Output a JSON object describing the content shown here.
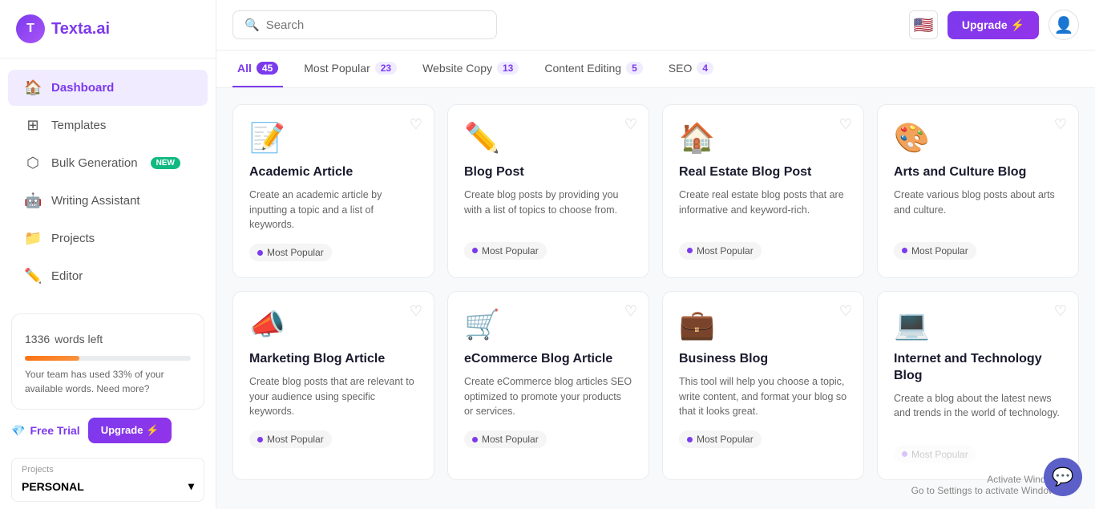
{
  "app": {
    "logo_letter": "T",
    "logo_prefix": "Texta",
    "logo_suffix": ".ai"
  },
  "sidebar": {
    "nav_items": [
      {
        "id": "dashboard",
        "label": "Dashboard",
        "icon": "🏠",
        "active": true
      },
      {
        "id": "templates",
        "label": "Templates",
        "icon": "⊞",
        "active": false
      },
      {
        "id": "bulk-generation",
        "label": "Bulk Generation",
        "icon": "⬡",
        "active": false,
        "badge": "NEW"
      },
      {
        "id": "writing-assistant",
        "label": "Writing Assistant",
        "icon": "🤖",
        "active": false
      },
      {
        "id": "projects",
        "label": "Projects",
        "icon": "📁",
        "active": false
      },
      {
        "id": "editor",
        "label": "Editor",
        "icon": "✏️",
        "active": false
      }
    ],
    "words_left": {
      "count": "1336",
      "label": "words left",
      "progress": 33,
      "desc": "Your team has used 33% of your available words. Need more?"
    },
    "free_trial_label": "Free Trial",
    "upgrade_btn_label": "Upgrade ⚡",
    "projects_section": {
      "label": "Projects",
      "value": "PERSONAL"
    }
  },
  "topbar": {
    "search_placeholder": "Search",
    "flag_emoji": "🇺🇸",
    "upgrade_btn_label": "Upgrade ⚡"
  },
  "filter_tabs": [
    {
      "id": "all",
      "label": "All",
      "count": "45",
      "active": true
    },
    {
      "id": "most-popular",
      "label": "Most Popular",
      "count": "23",
      "active": false
    },
    {
      "id": "website-copy",
      "label": "Website Copy",
      "count": "13",
      "active": false
    },
    {
      "id": "content-editing",
      "label": "Content Editing",
      "count": "5",
      "active": false
    },
    {
      "id": "seo",
      "label": "SEO",
      "count": "4",
      "active": false
    }
  ],
  "cards": [
    {
      "id": "academic-article",
      "emoji": "📝",
      "title": "Academic Article",
      "desc": "Create an academic article by inputting a topic and a list of keywords.",
      "badge": "Most Popular"
    },
    {
      "id": "blog-post",
      "emoji": "✏️",
      "title": "Blog Post",
      "desc": "Create blog posts by providing you with a list of topics to choose from.",
      "badge": "Most Popular"
    },
    {
      "id": "real-estate-blog-post",
      "emoji": "🏠",
      "title": "Real Estate Blog Post",
      "desc": "Create real estate blog posts that are informative and keyword-rich.",
      "badge": "Most Popular"
    },
    {
      "id": "arts-culture-blog",
      "emoji": "🎨",
      "title": "Arts and Culture Blog",
      "desc": "Create various blog posts about arts and culture.",
      "badge": "Most Popular"
    },
    {
      "id": "marketing-blog-article",
      "emoji": "📣",
      "title": "Marketing Blog Article",
      "desc": "Create blog posts that are relevant to your audience using specific keywords.",
      "badge": "Most Popular"
    },
    {
      "id": "ecommerce-blog-article",
      "emoji": "🛒",
      "title": "eCommerce Blog Article",
      "desc": "Create eCommerce blog articles SEO optimized to promote your products or services.",
      "badge": "Most Popular"
    },
    {
      "id": "business-blog",
      "emoji": "💼",
      "title": "Business Blog",
      "desc": "This tool will help you choose a topic, write content, and format your blog so that it looks great.",
      "badge": "Most Popular"
    },
    {
      "id": "internet-technology-blog",
      "emoji": "💻",
      "title": "Internet and Technology Blog",
      "desc": "Create a blog about the latest news and trends in the world of technology.",
      "badge": "Most Popular"
    }
  ],
  "watermark": "Activate Windows\nGo to Settings to activate Windows."
}
